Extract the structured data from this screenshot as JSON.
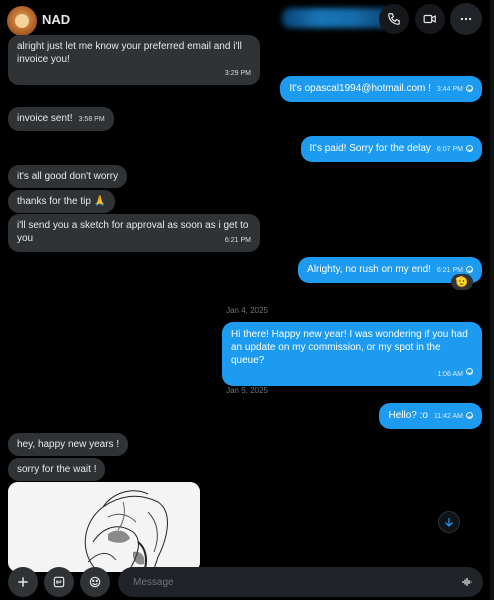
{
  "header": {
    "contact_name": "NAD",
    "icons": {
      "call": "phone-icon",
      "video": "video-icon",
      "more": "more-icon"
    }
  },
  "messages": [
    {
      "id": "m1",
      "side": "in",
      "text": "alright just let me know your preferred email and i'll invoice you!",
      "time": "3:29 PM"
    },
    {
      "id": "m2",
      "side": "out",
      "text": "It's opascal1994@hotmail.com !",
      "time": "3:44 PM"
    },
    {
      "id": "m3",
      "side": "in",
      "text": "invoice sent!",
      "time": "3:58 PM"
    },
    {
      "id": "m4",
      "side": "out",
      "text": "It's paid! Sorry for the delay",
      "time": "6:07 PM"
    },
    {
      "id": "m5",
      "side": "in",
      "text": "it's all good don't worry",
      "time": ""
    },
    {
      "id": "m6",
      "side": "in",
      "text": "thanks for the tip 🙏",
      "time": ""
    },
    {
      "id": "m7",
      "side": "in",
      "text": "i'll send you a sketch for approval as soon as i get to you",
      "time": "6:21 PM"
    },
    {
      "id": "m8",
      "side": "out",
      "text": "Alrighty, no rush on my end!",
      "time": "6:21 PM",
      "reaction": "🫡"
    },
    {
      "id": "m9",
      "side": "out",
      "text": "Hi there! Happy new year! I was wondering if you had an update on my commission, or my spot in the queue?",
      "time": "1:06 AM"
    },
    {
      "id": "m10",
      "side": "out",
      "text": "Hello? :o",
      "time": "11:42 AM"
    },
    {
      "id": "m11",
      "side": "in",
      "text": "hey, happy new years !",
      "time": ""
    },
    {
      "id": "m12",
      "side": "in",
      "text": "sorry for the wait !",
      "time": ""
    }
  ],
  "dates": {
    "d1": "Jan 4, 2025",
    "d2": "Jan 5, 2025"
  },
  "composer": {
    "placeholder": "Message",
    "icons": {
      "add": "plus-icon",
      "gif": "gif-icon",
      "emoji": "emoji-icon",
      "voice": "voice-icon"
    }
  },
  "colors": {
    "outgoing": "#1d9bf0",
    "incoming": "#2f3336",
    "background": "#000000"
  }
}
